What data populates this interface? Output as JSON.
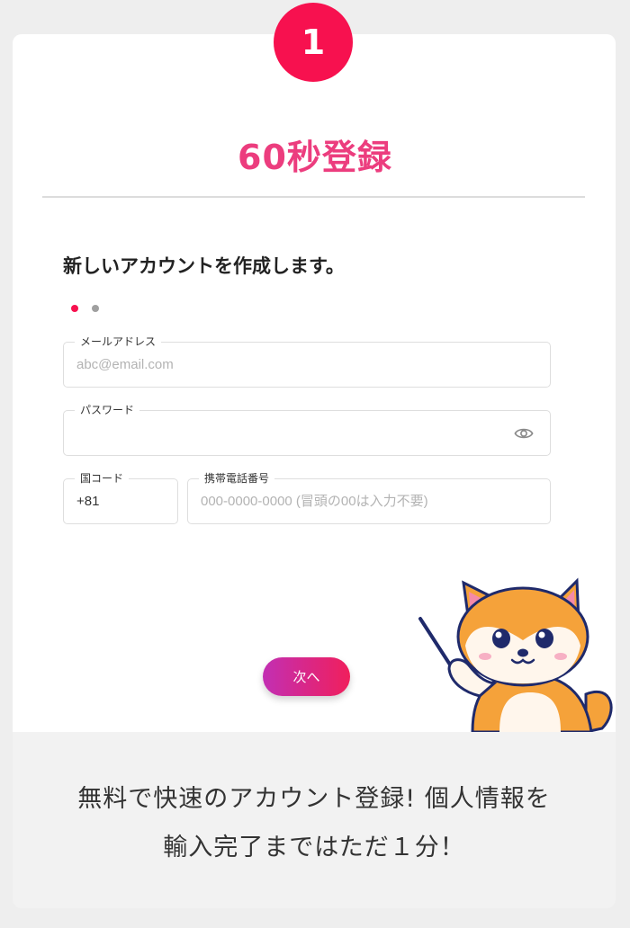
{
  "step": {
    "number": "1",
    "color": "#f7114f"
  },
  "header": {
    "title": "60秒登録",
    "title_color": "#ec3d7e"
  },
  "form": {
    "subtitle": "新しいアカウントを作成します。",
    "pager": {
      "current": 1,
      "total": 2
    },
    "email": {
      "label": "メールアドレス",
      "value": "",
      "placeholder": "abc@email.com"
    },
    "password": {
      "label": "パスワード",
      "value": "",
      "placeholder": "",
      "toggle_icon": "eye-icon"
    },
    "country_code": {
      "label": "国コード",
      "value": "+81"
    },
    "phone": {
      "label": "携帯電話番号",
      "value": "",
      "placeholder": "000-0000-0000 (冒頭の00は入力不要)"
    },
    "next_label": "次へ"
  },
  "promo": {
    "line1": "無料で快速のアカウント登録! 個人情報を",
    "line2": "輸入完了まではただ１分！"
  },
  "mascot": {
    "icon": "shiba-dog-pointer-mascot"
  }
}
